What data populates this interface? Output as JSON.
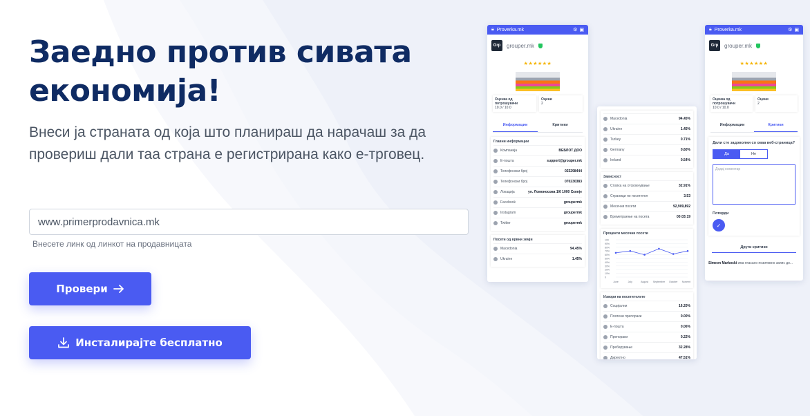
{
  "hero": {
    "title": "Заедно против сивата економија!",
    "description": "Внеси ја страната од која што планираш да нарачаш за да провериш дали таа страна е регистрирана како е-трговец."
  },
  "search": {
    "placeholder": "www.primerprodavnica.mk",
    "hint": "Внесете линк од линкот на продавницата"
  },
  "buttons": {
    "check_label": "Провери",
    "install_label": "Инсталирајте бесплатно"
  },
  "colors": {
    "primary": "#4a5bf2",
    "title": "#0f2b63",
    "wave": "#eef1f9"
  },
  "phone_left": {
    "bar_title": "Proverka.mk",
    "logo": "Grp",
    "site": "grouper.mk",
    "stars": "★★★★★★",
    "stat1_label": "Оценка од потрошувачи",
    "stat1_value": "10.0 / 10.0",
    "stat2_label": "Оцени",
    "stat2_value": "2",
    "tab1": "Информации",
    "tab2": "Критики",
    "info_title": "Главни информации",
    "info_rows": [
      {
        "k": "Компанија",
        "v": "ВЕБЛОТ ДОО"
      },
      {
        "k": "E-пошта",
        "v": "support@grouper.mk"
      },
      {
        "k": "Телефонски број",
        "v": "023298444"
      },
      {
        "k": "Телефонски број",
        "v": "070230383"
      },
      {
        "k": "Локација",
        "v": "ул. Ломоносова 1/6 1000 Скопје"
      },
      {
        "k": "Facebook",
        "v": "groupermk"
      },
      {
        "k": "Instagram",
        "v": "groupermk"
      },
      {
        "k": "Twitter",
        "v": "groupermk"
      }
    ],
    "visits_title": "Посети од врвни земји",
    "visit_rows": [
      {
        "k": "Macedonia",
        "v": "94.45%"
      },
      {
        "k": "Ukraine",
        "v": "1.45%"
      }
    ]
  },
  "phone_mid": {
    "country_rows": [
      {
        "k": "Macedonia",
        "v": "94.45%"
      },
      {
        "k": "Ukraine",
        "v": "1.45%"
      },
      {
        "k": "Turkey",
        "v": "0.71%"
      },
      {
        "k": "Germany",
        "v": "0.60%"
      },
      {
        "k": "Ireland",
        "v": "0.54%"
      }
    ],
    "engagement_title": "Зависност",
    "engagement_rows": [
      {
        "k": "Стапка на отскокнување",
        "v": "32.91%"
      },
      {
        "k": "Страници по посетител",
        "v": "3.53"
      },
      {
        "k": "Месечни посети",
        "v": "92,909,892"
      },
      {
        "k": "Времетраење на посета",
        "v": "00:03:19"
      }
    ],
    "chart_title": "Проценти месечни посети",
    "sources_title": "Извори на посетителите",
    "source_rows": [
      {
        "k": "Социјални",
        "v": "16.20%"
      },
      {
        "k": "Платени препораки",
        "v": "0.00%"
      },
      {
        "k": "E-пошта",
        "v": "0.06%"
      },
      {
        "k": "Препораки",
        "v": "0.22%"
      },
      {
        "k": "Пребарување",
        "v": "32.28%"
      },
      {
        "k": "Директно",
        "v": "47.51%"
      }
    ]
  },
  "chart_data": {
    "type": "line",
    "categories": [
      "June",
      "July",
      "August",
      "September",
      "October",
      "November"
    ],
    "values": [
      65,
      70,
      60,
      76,
      62,
      70
    ],
    "ylim": [
      0,
      100
    ],
    "yticks": [
      "100",
      "90%",
      "80%",
      "70%",
      "60%",
      "50%",
      "40%",
      "30%",
      "20%",
      "10%",
      "0"
    ],
    "title": "Проценти месечни посети"
  },
  "phone_right": {
    "bar_title": "Proverka.mk",
    "logo": "Grp",
    "site": "grouper.mk",
    "stars": "★★★★★★",
    "stat1_label": "Оценка од потрошувачи",
    "stat1_value": "10.0 / 10.0",
    "stat2_label": "Оцени",
    "stat2_value": "2",
    "tab1": "Информации",
    "tab2": "Критики",
    "question": "Дали сте задоволни со оваа веб-страница?",
    "yes": "Да",
    "no": "Не",
    "textarea_placeholder": "Додај коментар",
    "send_label": "Потврди",
    "other_reviews": "Други критики",
    "review_user": "Simeon Markoski",
    "review_text": "има гласано позитивно запис до..."
  }
}
